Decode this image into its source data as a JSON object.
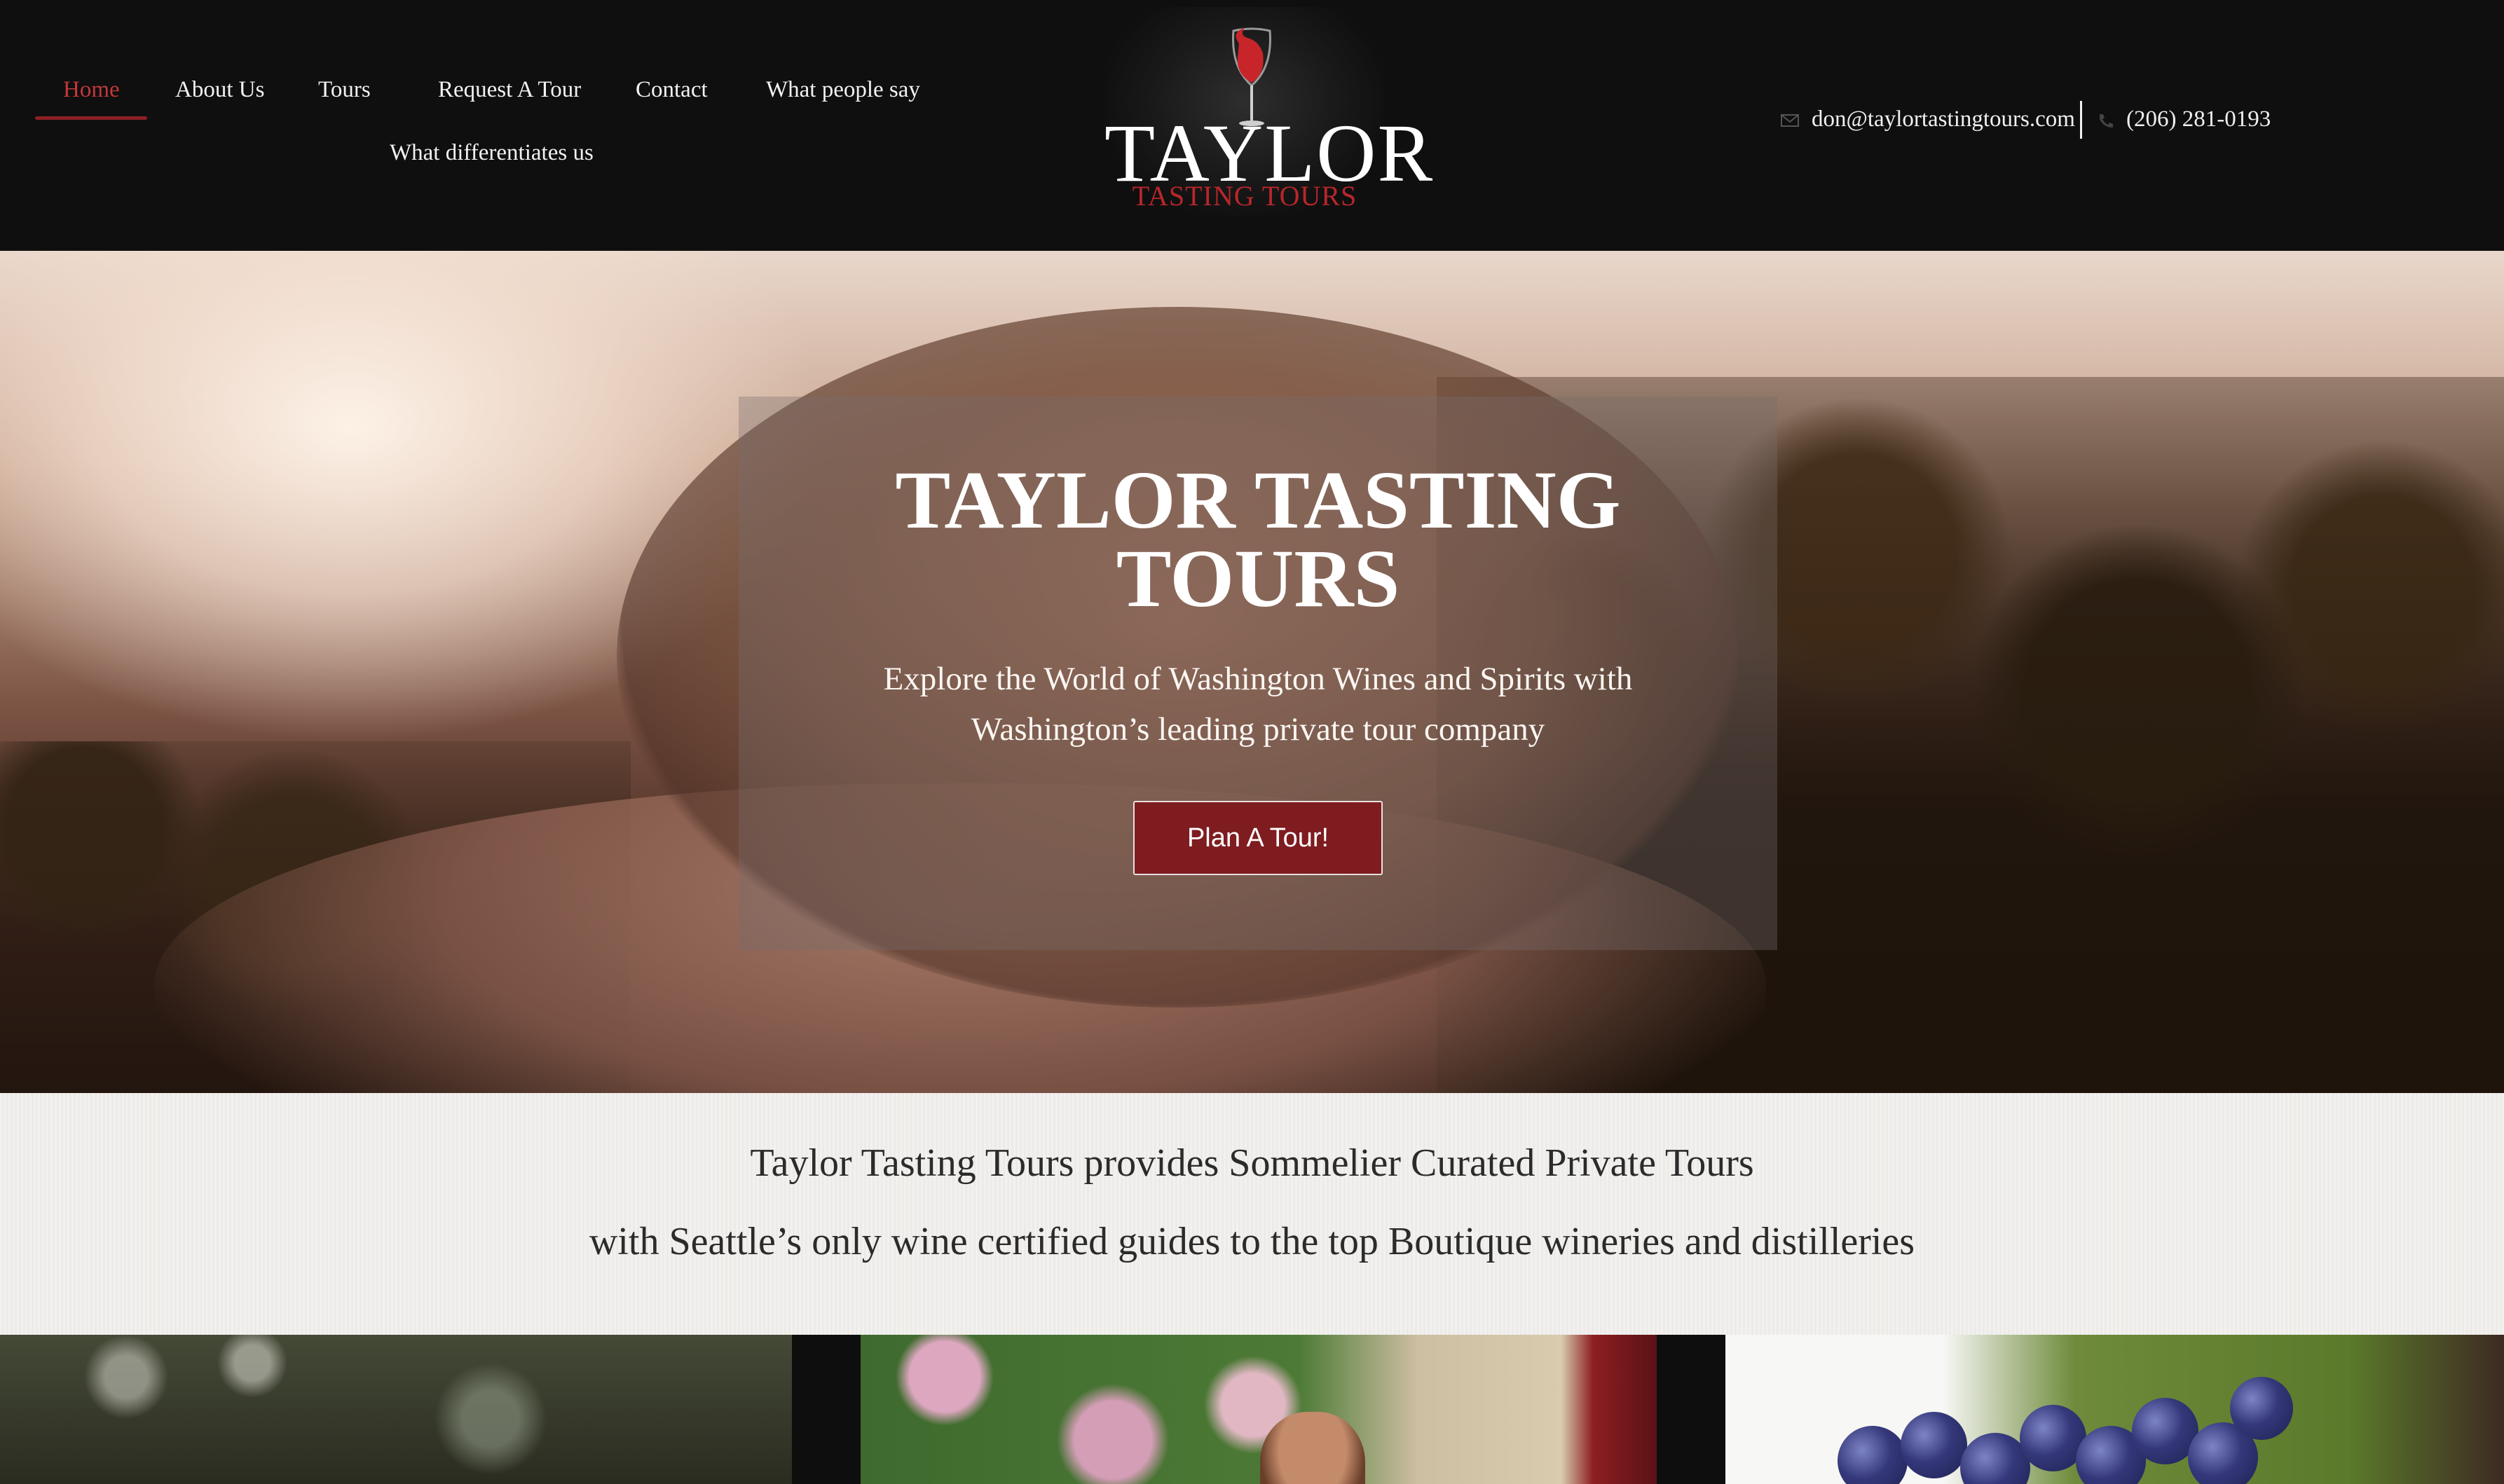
{
  "nav": {
    "items": [
      {
        "label": "Home",
        "active": true
      },
      {
        "label": "About Us"
      },
      {
        "label": "Tours"
      },
      {
        "label": "Request A Tour"
      },
      {
        "label": "Contact"
      },
      {
        "label": "What people say"
      },
      {
        "label": "What differentiates us"
      }
    ]
  },
  "logo": {
    "title": "TAYLOR",
    "subtitle": "TASTING TOURS"
  },
  "contact": {
    "email": "don@taylortastingtours.com",
    "phone": "(206) 281-0193",
    "email_icon": "envelope-icon",
    "phone_icon": "phone-icon"
  },
  "hero": {
    "title_line1": "TAYLOR TASTING",
    "title_line2": "TOURS",
    "subtitle_line1": "Explore the World of Washington Wines and Spirits with",
    "subtitle_line2": "Washington’s leading private tour company",
    "cta_label": "Plan A Tour!"
  },
  "intro": {
    "line1": "Taylor Tasting Tours provides Sommelier Curated Private Tours",
    "line2": "with Seattle’s only wine certified guides to the top Boutique wineries and distilleries"
  },
  "colors": {
    "accent": "#8d1f24",
    "header_bg": "#0f0f0f",
    "cta_bg": "#7e1c20"
  }
}
